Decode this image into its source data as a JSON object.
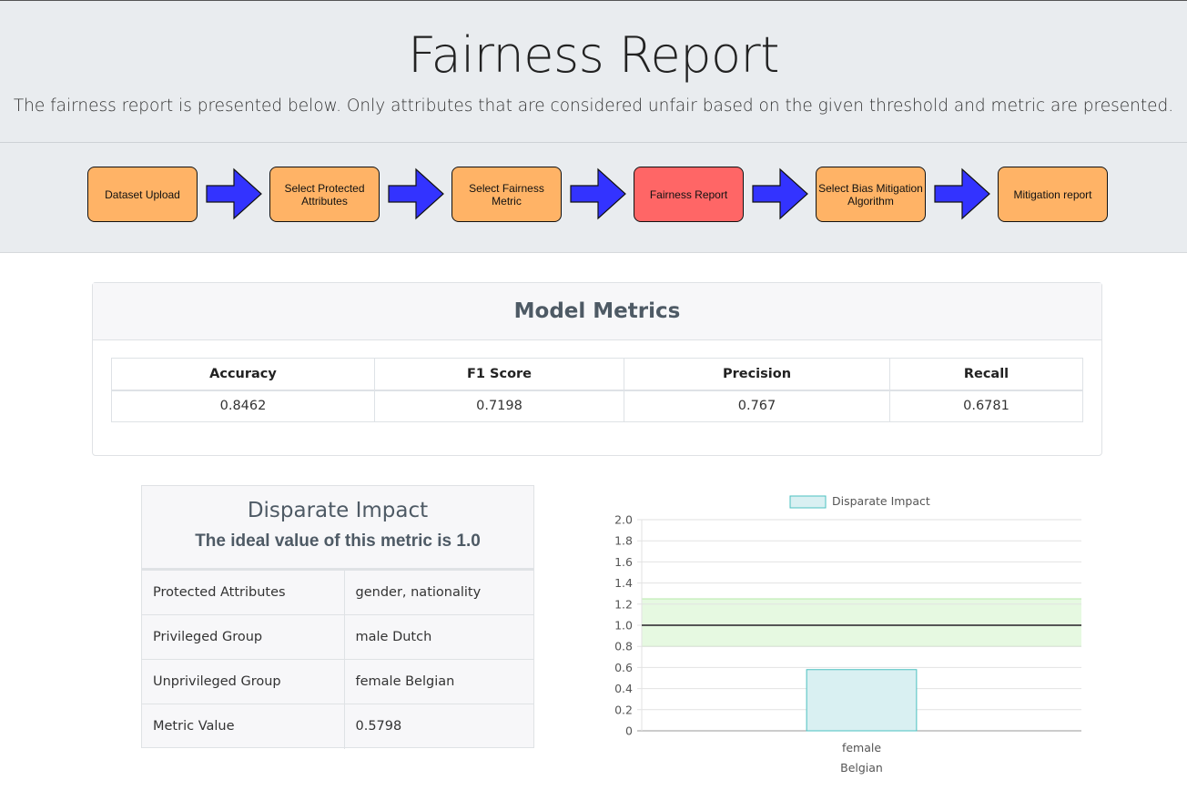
{
  "header": {
    "title": "Fairness Report",
    "subtitle": "The fairness report is presented below. Only attributes that are considered unfair based on the given threshold and metric are presented."
  },
  "workflow": {
    "steps": [
      {
        "label": "Dataset Upload"
      },
      {
        "label": "Select Protected Attributes"
      },
      {
        "label": "Select Fairness Metric"
      },
      {
        "label": "Fairness Report"
      },
      {
        "label": "Select Bias Mitigation Algorithm"
      },
      {
        "label": "Mitigation report"
      }
    ],
    "active_step": "Fairness Report",
    "colors": {
      "step": "#ffb366",
      "active": "#ff6666",
      "arrow": "#3333ff"
    }
  },
  "model_metrics": {
    "title": "Model Metrics",
    "columns": [
      "Accuracy",
      "F1 Score",
      "Precision",
      "Recall"
    ],
    "values": [
      "0.8462",
      "0.7198",
      "0.767",
      "0.6781"
    ]
  },
  "disparate_impact": {
    "title": "Disparate Impact",
    "ideal": "The ideal value of this metric is 1.0",
    "rows": [
      {
        "key": "Protected Attributes",
        "value": "gender, nationality"
      },
      {
        "key": "Privileged Group",
        "value": "male Dutch"
      },
      {
        "key": "Unprivileged Group",
        "value": "female Belgian"
      },
      {
        "key": "Metric Value",
        "value": "0.5798"
      }
    ]
  },
  "chart_data": {
    "type": "bar",
    "categories": [
      [
        "female",
        "Belgian"
      ]
    ],
    "series": [
      {
        "name": "Disparate Impact",
        "values": [
          0.5798
        ]
      }
    ],
    "ylim": [
      0,
      2.0
    ],
    "yticks": [
      "0",
      "0.2",
      "0.4",
      "0.6",
      "0.8",
      "1.0",
      "1.2",
      "1.4",
      "1.6",
      "1.8",
      "2.0"
    ],
    "reference_line": 1.0,
    "fair_band": [
      0.8,
      1.25
    ],
    "legend": "top",
    "grid": true,
    "colors": {
      "bar_fill": "#d9f0f2",
      "bar_stroke": "#4bc0c0",
      "band": "#e6f9e1",
      "band_edge": "#b5eaa9",
      "ref_line": "#555555"
    }
  }
}
